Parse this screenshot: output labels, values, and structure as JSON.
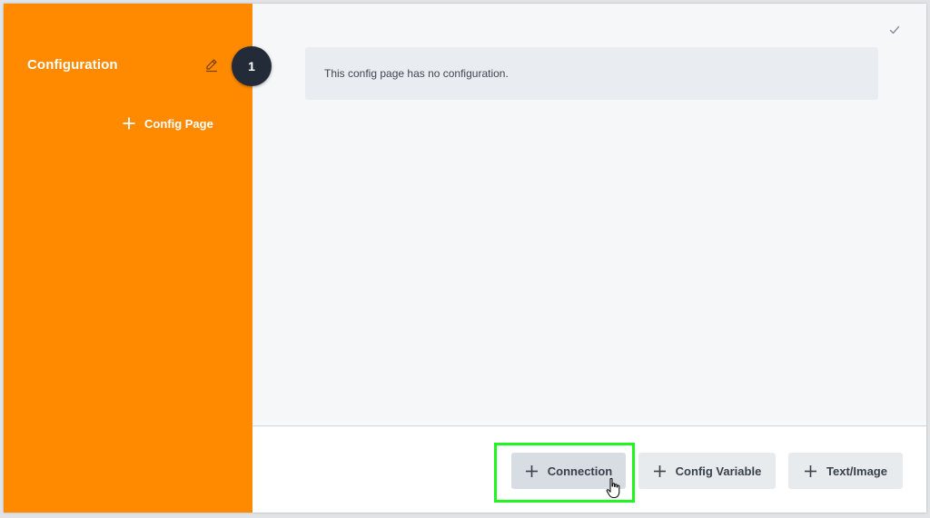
{
  "sidebar": {
    "title": "Configuration",
    "add_page_label": "Config Page",
    "page_number": "1",
    "accent_color": "#ff8a00"
  },
  "main": {
    "empty_message": "This config page has no configuration."
  },
  "footer": {
    "buttons": [
      {
        "label": "Connection",
        "icon": "plus-icon",
        "highlighted": true
      },
      {
        "label": "Config Variable",
        "icon": "plus-icon"
      },
      {
        "label": "Text/Image",
        "icon": "plus-icon"
      }
    ],
    "highlight_color": "#1ff51f"
  },
  "icons": {
    "edit": "pencil-icon",
    "check": "check-icon",
    "cursor": "hand-pointer-icon"
  }
}
